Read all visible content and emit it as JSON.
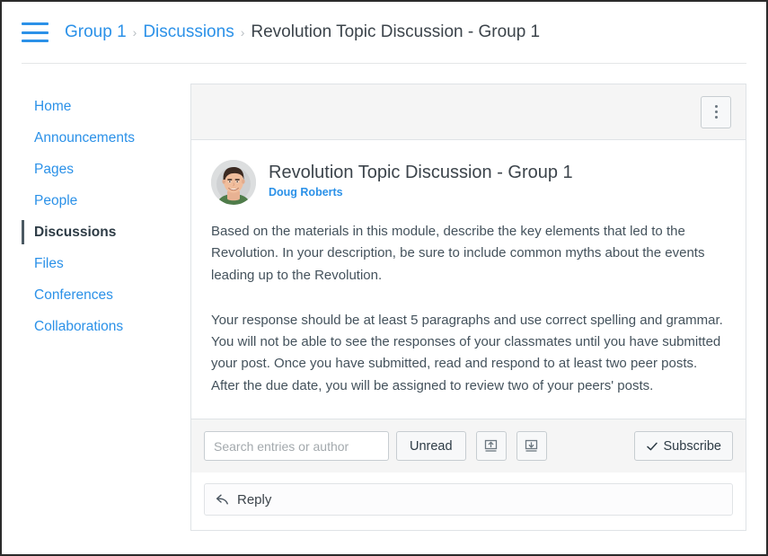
{
  "header": {
    "menu_icon": "hamburger-icon",
    "breadcrumb": [
      {
        "label": "Group 1",
        "is_link": true
      },
      {
        "label": "Discussions",
        "is_link": true
      },
      {
        "label": "Revolution Topic Discussion - Group 1",
        "is_link": false
      }
    ],
    "separator": "›"
  },
  "sidebar": {
    "items": [
      {
        "label": "Home",
        "active": false
      },
      {
        "label": "Announcements",
        "active": false
      },
      {
        "label": "Pages",
        "active": false
      },
      {
        "label": "People",
        "active": false
      },
      {
        "label": "Discussions",
        "active": true
      },
      {
        "label": "Files",
        "active": false
      },
      {
        "label": "Conferences",
        "active": false
      },
      {
        "label": "Collaborations",
        "active": false
      }
    ]
  },
  "card": {
    "toolbar": {
      "kebab_label": "Manage Discussion",
      "kebab_icon": "kebab-menu-icon"
    },
    "post": {
      "avatar_alt": "Doug Roberts avatar",
      "title": "Revolution Topic Discussion - Group 1",
      "author": "Doug Roberts",
      "paragraphs": [
        "Based on the materials in this module, describe the key elements that led to the Revolution. In your description, be sure to include common myths about the events leading up to the Revolution.",
        "Your response should be at least 5 paragraphs and use correct spelling and grammar. You will not be able to see the responses of your classmates until you have submitted your post. Once you have submitted, read and respond to at least two peer posts. After the due date, you will be assigned to review two of your peers' posts."
      ]
    },
    "entry_toolbar": {
      "search_placeholder": "Search entries or author",
      "search_value": "",
      "unread_label": "Unread",
      "collapse_icon": "collapse-all-icon",
      "expand_icon": "expand-all-icon",
      "subscribe_label": "Subscribe",
      "subscribe_check_icon": "check-icon"
    },
    "reply": {
      "label": "Reply",
      "icon": "reply-arrow-icon"
    }
  },
  "colors": {
    "link_blue": "#2b91e8",
    "text_dark": "#3c444b",
    "body_text": "#44525c",
    "border": "#dfe3e6",
    "toolbar_bg": "#f5f5f5",
    "active_bar": "#4b5962"
  }
}
